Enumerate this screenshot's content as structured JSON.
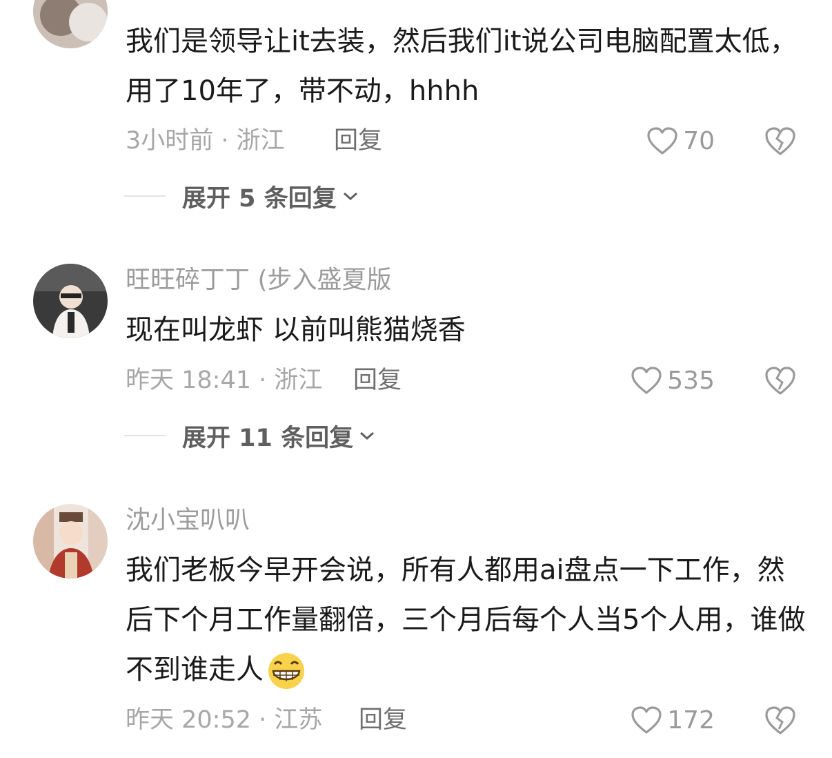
{
  "comments": [
    {
      "username": "",
      "text": "我们是领导让it去装，然后我们it说公司电脑配置太低，用了10年了，带不动，hhhh",
      "time_location": "3小时前 · 浙江",
      "reply_label": "回复",
      "likes": "70",
      "expand_label": "展开 5 条回复"
    },
    {
      "username": "旺旺碎丁丁 (步入盛夏版",
      "text": "现在叫龙虾 以前叫熊猫烧香",
      "time_location": "昨天 18:41 · 浙江",
      "reply_label": "回复",
      "likes": "535",
      "expand_label": "展开 11 条回复"
    },
    {
      "username": "沈小宝叭叭",
      "text": "我们老板今早开会说，所有人都用ai盘点一下工作，然后下个月工作量翻倍，三个月后每个人当5个人用，谁做不到谁走人",
      "time_location": "昨天 20:52 · 江苏",
      "reply_label": "回复",
      "likes": "172"
    }
  ],
  "icons": {
    "like": "heart-outline-icon",
    "dislike": "broken-heart-icon",
    "expand": "chevron-down-icon",
    "emoji": "grinning-emoji-icon"
  },
  "colors": {
    "text": "#1a1a1a",
    "meta": "#a7a7a7",
    "icon": "#9a9a9a"
  }
}
